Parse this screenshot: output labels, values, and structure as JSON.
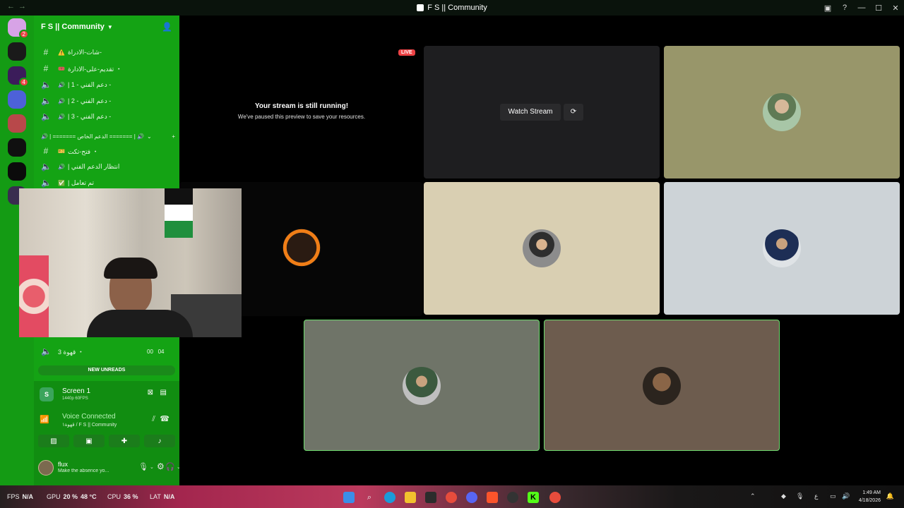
{
  "titlebar": {
    "back": "←",
    "forward": "→",
    "title": "F S || Community"
  },
  "server": {
    "name": "F S || Community"
  },
  "guild_badges": [
    "2",
    "4"
  ],
  "channels": [
    {
      "type": "text",
      "icon": "#",
      "emoji": "⚠️",
      "label": "شات-الادراة-"
    },
    {
      "type": "text",
      "icon": "#",
      "emoji": "🎟️",
      "label": "تقديم-على-الادارة ・"
    },
    {
      "type": "voice",
      "icon": "🔈",
      "emoji": "🔊",
      "label": "| دعم الفني - 1 -"
    },
    {
      "type": "voice",
      "icon": "🔈",
      "emoji": "🔊",
      "label": "| دعم الفني - 2 -"
    },
    {
      "type": "voice",
      "icon": "🔈",
      "emoji": "🔊",
      "label": "| دعم الفني - 3 -"
    }
  ],
  "category": {
    "label": "🔊 | ======= الدعم الخاص ======= | 🔊",
    "add": "+"
  },
  "channels2": [
    {
      "type": "text",
      "icon": "#",
      "emoji": "🎫",
      "label": "فتح-تكت ・"
    },
    {
      "type": "voice",
      "icon": "🔈",
      "emoji": "🔊",
      "label": "| انتظار الدعم الفني"
    },
    {
      "type": "voice",
      "icon": "🔈",
      "emoji": "✅",
      "label": "| تم تعامل"
    }
  ],
  "bottom_channel": {
    "icon": "🔈",
    "label": "قهوة 3 ・",
    "count1": "00",
    "count2": "04"
  },
  "new_unreads": "NEW UNREADS",
  "stream": {
    "title": "Screen 1",
    "subtitle": "1440p 60FPS"
  },
  "voice": {
    "status": "Voice Connected",
    "location": "قهوة١ / F S || Community"
  },
  "user": {
    "name": "flux",
    "status": "Make the absence yo..."
  },
  "stage": {
    "live_badge": "LIVE",
    "paused_title": "Your stream is still running!",
    "paused_subtitle": "We've paused this preview to save your resources.",
    "watch_stream": "Watch Stream"
  },
  "taskbar": {
    "fps_label": "FPS",
    "fps_value": "N/A",
    "gpu_label": "GPU",
    "gpu_value": "20 %",
    "gpu_temp": "48 °C",
    "cpu_label": "CPU",
    "cpu_value": "36 %",
    "lat_label": "LAT",
    "lat_value": "N/A",
    "lang": "ع",
    "time": "1:49 AM",
    "date": "4/18/2026",
    "apps": [
      "windows-start",
      "search",
      "edge",
      "file-explorer",
      "store",
      "chrome",
      "discord",
      "brave",
      "obs",
      "kick",
      "chrome-2"
    ]
  },
  "colors": {
    "sidebar": "#14a314",
    "guilds": "#149b14",
    "live": "#ed4245",
    "stage_bg": "#000000"
  }
}
